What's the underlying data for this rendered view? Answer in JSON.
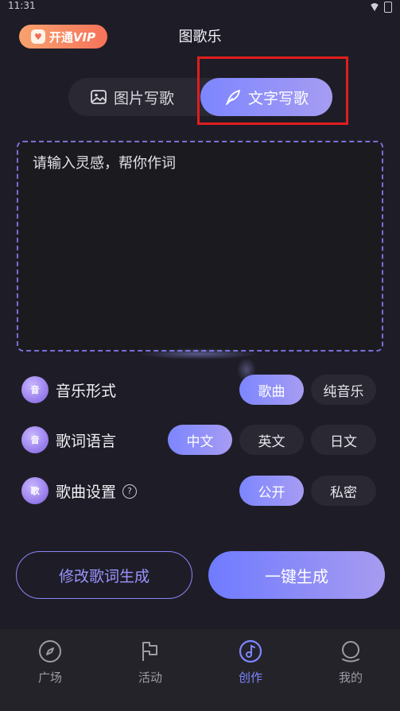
{
  "status": {
    "time": "11:31"
  },
  "header": {
    "vip_label": "开通",
    "vip_suffix": "VIP",
    "title": "图歌乐"
  },
  "mode_tabs": [
    {
      "label": "图片写歌",
      "active": false
    },
    {
      "label": "文字写歌",
      "active": true
    }
  ],
  "lyric": {
    "placeholder": "请输入灵感，帮你作词",
    "value": ""
  },
  "options": {
    "music_form": {
      "label": "音乐形式",
      "icon_text": "音",
      "choices": [
        "歌曲",
        "纯音乐"
      ],
      "selected": "歌曲"
    },
    "lyric_language": {
      "label": "歌词语言",
      "icon_text": "音",
      "choices": [
        "中文",
        "英文",
        "日文"
      ],
      "selected": "中文"
    },
    "song_setting": {
      "label": "歌曲设置",
      "icon_text": "歌",
      "help": "?",
      "choices": [
        "公开",
        "私密"
      ],
      "selected": "公开"
    }
  },
  "actions": {
    "modify": "修改歌词生成",
    "generate": "一键生成"
  },
  "nav": [
    {
      "label": "广场",
      "icon": "compass-icon"
    },
    {
      "label": "活动",
      "icon": "flag-icon"
    },
    {
      "label": "创作",
      "icon": "music-note-icon",
      "active": true
    },
    {
      "label": "我的",
      "icon": "profile-icon"
    }
  ],
  "colors": {
    "accent": "#7d86ff",
    "background": "#1e1d27",
    "vip": "#f6735a",
    "highlight_box": "#e01e1e"
  }
}
